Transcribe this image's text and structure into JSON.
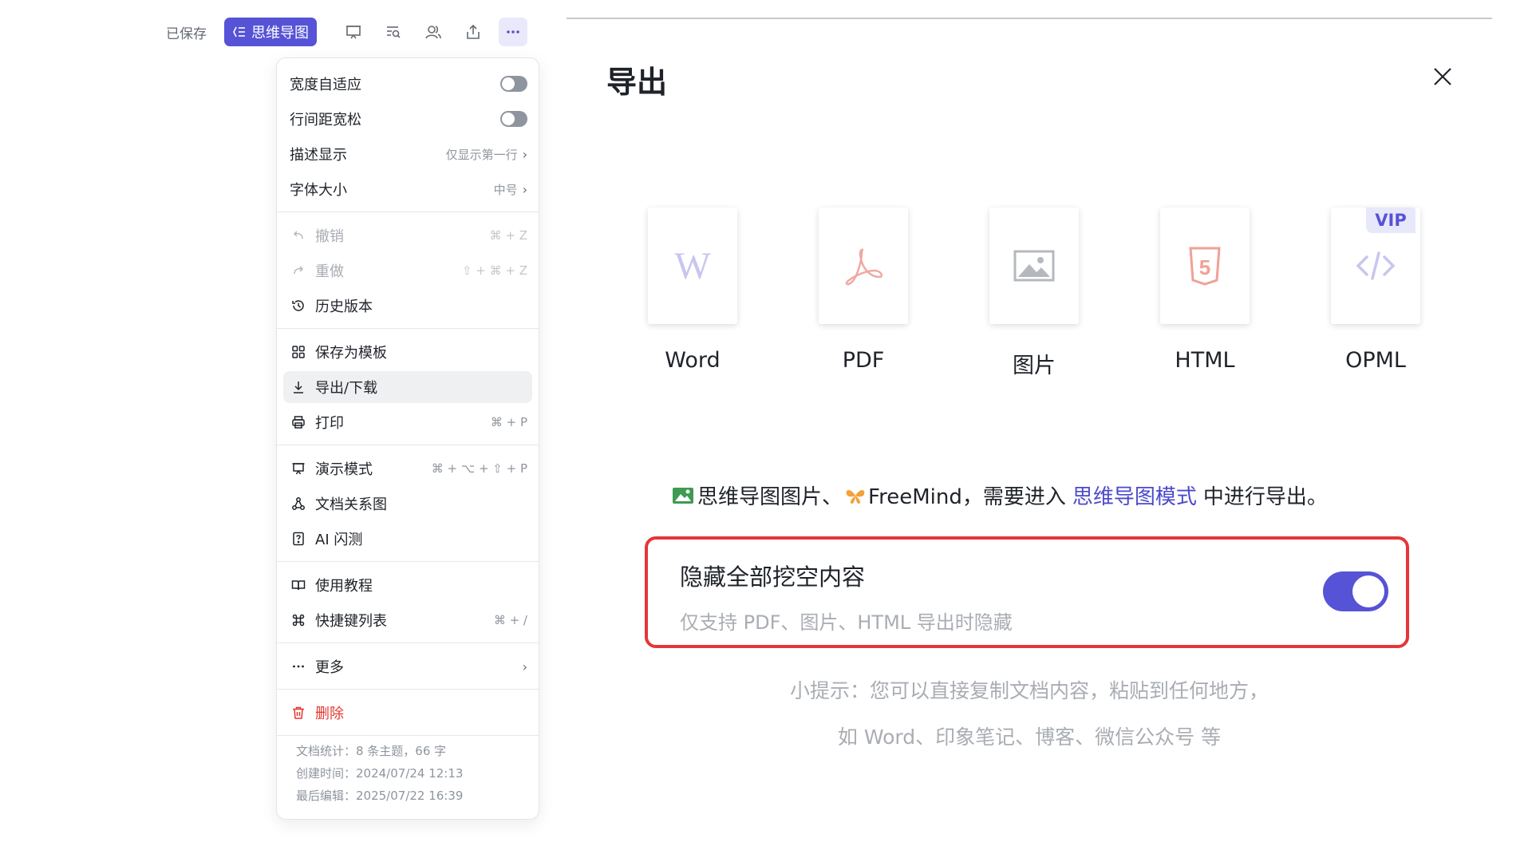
{
  "toolbar": {
    "saved": "已保存",
    "mindmap_label": "思维导图"
  },
  "menu": {
    "toggles": [
      {
        "label": "宽度自适应"
      },
      {
        "label": "行间距宽松"
      }
    ],
    "desc_display": {
      "label": "描述显示",
      "value": "仅显示第一行"
    },
    "font_size": {
      "label": "字体大小",
      "value": "中号"
    },
    "undo": {
      "label": "撤销",
      "shortcut": "⌘ + Z"
    },
    "redo": {
      "label": "重做",
      "shortcut": "⇧ + ⌘ + Z"
    },
    "history": {
      "label": "历史版本"
    },
    "save_template": {
      "label": "保存为模板"
    },
    "export": {
      "label": "导出/下载"
    },
    "print": {
      "label": "打印",
      "shortcut": "⌘ + P"
    },
    "present": {
      "label": "演示模式",
      "shortcut": "⌘ + ⌥ + ⇧ + P"
    },
    "relation": {
      "label": "文档关系图"
    },
    "ai_quiz": {
      "label": "AI 闪测"
    },
    "tutorial": {
      "label": "使用教程"
    },
    "shortcuts": {
      "label": "快捷键列表",
      "shortcut": "⌘ + /"
    },
    "more": {
      "label": "更多"
    },
    "delete": {
      "label": "删除"
    },
    "stats": {
      "count": "文档统计：8 条主题，66 字",
      "created": "创建时间：2024/07/24 12:13",
      "edited": "最后编辑：2025/07/22 16:39"
    }
  },
  "export_panel": {
    "title": "导出",
    "formats": [
      {
        "label": "Word",
        "icon": "word-icon"
      },
      {
        "label": "PDF",
        "icon": "pdf-icon"
      },
      {
        "label": "图片",
        "icon": "image-icon"
      },
      {
        "label": "HTML",
        "icon": "html5-icon"
      },
      {
        "label": "OPML",
        "icon": "code-icon"
      }
    ],
    "vip_badge": "VIP",
    "tip_prefix": "思维导图图片、",
    "tip_freemind": "FreeMind，需要进入",
    "tip_link": "思维导图模式",
    "tip_suffix": "中进行导出。",
    "hide_title": "隐藏全部挖空内容",
    "hide_sub": "仅支持 PDF、图片、HTML 导出时隐藏",
    "hide_enabled": true,
    "small_tip_1": "小提示：您可以直接复制文档内容，粘贴到任何地方，",
    "small_tip_2": "如 Word、印象笔记、博客、微信公众号 等"
  },
  "colors": {
    "accent": "#5653d6",
    "danger": "#e5372e",
    "highlight_box": "#e6353a"
  }
}
